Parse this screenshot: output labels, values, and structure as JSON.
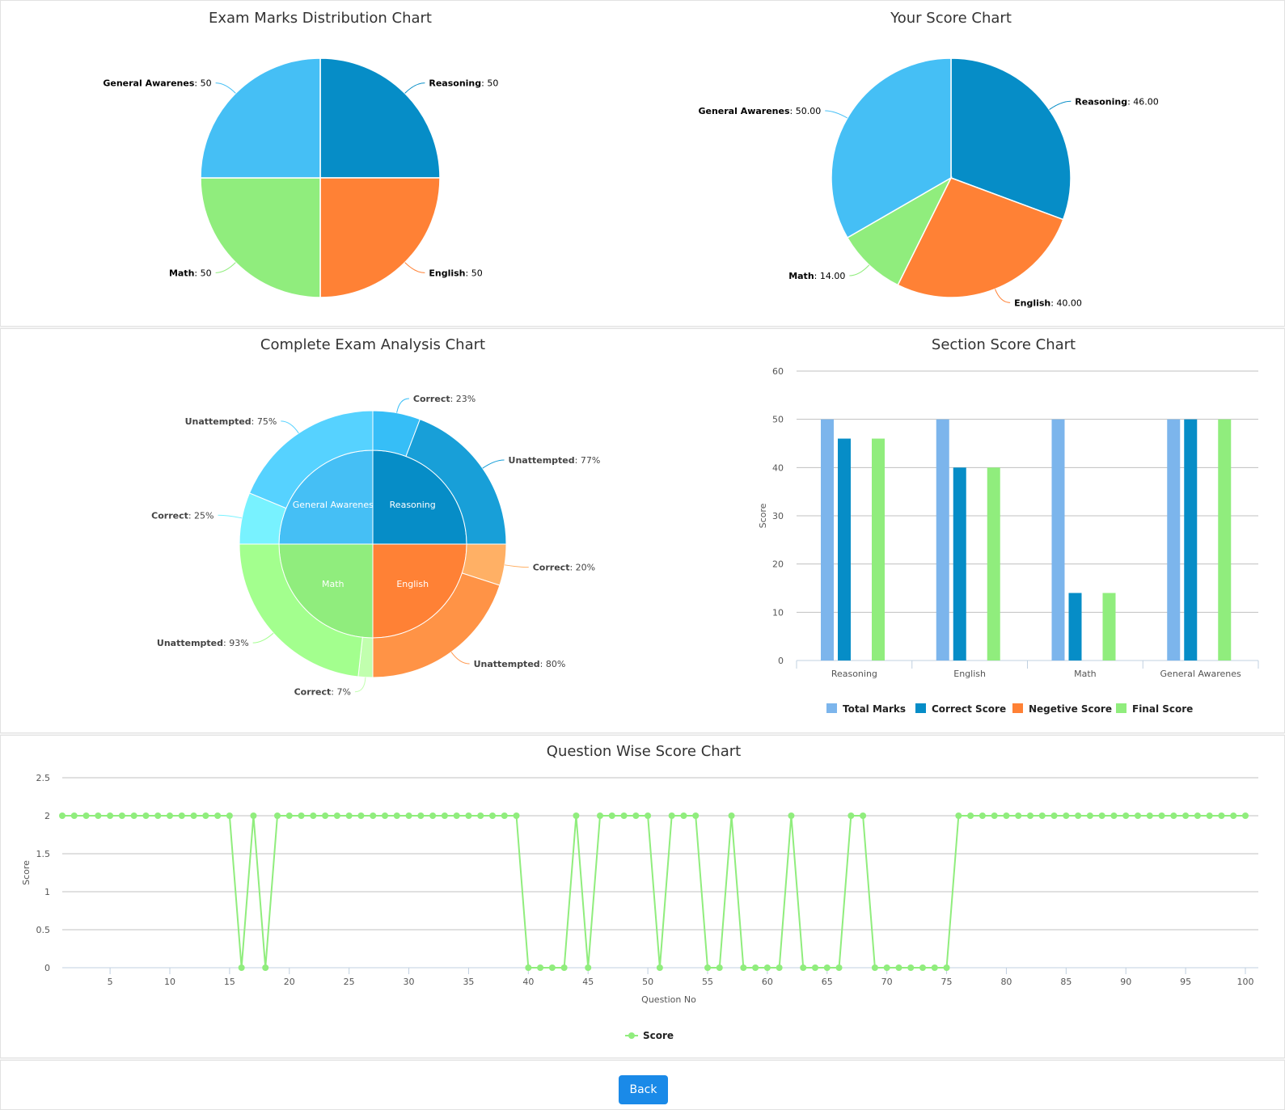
{
  "colors": {
    "reasoning": "#068dc7",
    "english": "#ff8135",
    "math": "#90ed7d",
    "general": "#45bff5",
    "total_marks": "#7cb5ec",
    "correct_score": "#068dc7",
    "negative_score": "#ff8135",
    "final_score": "#90ed7d",
    "line": "#90ed7d",
    "back_button": "#1a8ae8"
  },
  "chart_data": [
    {
      "id": "exam-marks-distribution",
      "type": "pie",
      "title": "Exam Marks Distribution Chart",
      "slices": [
        {
          "name": "Reasoning",
          "value": 50,
          "label_value": "50"
        },
        {
          "name": "English",
          "value": 50,
          "label_value": "50"
        },
        {
          "name": "Math",
          "value": 50,
          "label_value": "50"
        },
        {
          "name": "General Awarenes",
          "value": 50,
          "label_value": "50"
        }
      ]
    },
    {
      "id": "your-score",
      "type": "pie",
      "title": "Your Score Chart",
      "slices": [
        {
          "name": "Reasoning",
          "value": 46,
          "label_value": "46.00"
        },
        {
          "name": "English",
          "value": 40,
          "label_value": "40.00"
        },
        {
          "name": "Math",
          "value": 14,
          "label_value": "14.00"
        },
        {
          "name": "General Awarenes",
          "value": 50,
          "label_value": "50.00"
        }
      ]
    },
    {
      "id": "complete-exam-analysis",
      "type": "pie",
      "title": "Complete Exam Analysis Chart",
      "inner": [
        {
          "name": "Reasoning",
          "value": 25
        },
        {
          "name": "English",
          "value": 25
        },
        {
          "name": "Math",
          "value": 25
        },
        {
          "name": "General Awarenes",
          "value": 25
        }
      ],
      "outer": [
        {
          "section": "Reasoning",
          "name": "Correct",
          "value": 23,
          "label": "23%",
          "color": "#36bef7"
        },
        {
          "section": "Reasoning",
          "name": "Unattempted",
          "value": 77,
          "label": "77%",
          "color": "#189fd8"
        },
        {
          "section": "English",
          "name": "Correct",
          "value": 20,
          "label": "20%",
          "color": "#ffb065"
        },
        {
          "section": "English",
          "name": "Unattempted",
          "value": 80,
          "label": "80%",
          "color": "#ff9346"
        },
        {
          "section": "Math",
          "name": "Correct",
          "value": 7,
          "label": "7%",
          "color": "#c1ffae"
        },
        {
          "section": "Math",
          "name": "Unattempted",
          "value": 93,
          "label": "93%",
          "color": "#a3ff8e"
        },
        {
          "section": "General Awarenes",
          "name": "Correct",
          "value": 25,
          "label": "25%",
          "color": "#78f2ff"
        },
        {
          "section": "General Awarenes",
          "name": "Unattempted",
          "value": 75,
          "label": "75%",
          "color": "#56d2ff"
        }
      ]
    },
    {
      "id": "section-score",
      "type": "bar",
      "title": "Section Score Chart",
      "categories": [
        "Reasoning",
        "English",
        "Math",
        "General Awarenes"
      ],
      "ylabel": "Score",
      "xlabel": "",
      "ylim": [
        0,
        60
      ],
      "yticks": [
        0,
        10,
        20,
        30,
        40,
        50,
        60
      ],
      "grid": true,
      "legend_position": "bottom",
      "series": [
        {
          "name": "Total Marks",
          "values": [
            50,
            50,
            50,
            50
          ]
        },
        {
          "name": "Correct Score",
          "values": [
            46,
            40,
            14,
            50
          ]
        },
        {
          "name": "Negetive Score",
          "values": [
            0,
            0,
            0,
            0
          ]
        },
        {
          "name": "Final Score",
          "values": [
            46,
            40,
            14,
            50
          ]
        }
      ]
    },
    {
      "id": "question-wise-score",
      "type": "line",
      "title": "Question Wise Score Chart",
      "xlabel": "Question No",
      "ylabel": "Score",
      "xlim": [
        1,
        100
      ],
      "ylim": [
        0,
        2.5
      ],
      "xticks": [
        5,
        10,
        15,
        20,
        25,
        30,
        35,
        40,
        45,
        50,
        55,
        60,
        65,
        70,
        75,
        80,
        85,
        90,
        95,
        100
      ],
      "yticks": [
        "0",
        "0.5",
        "1",
        "1.5",
        "2",
        "2.5"
      ],
      "grid": true,
      "legend_position": "bottom",
      "series": [
        {
          "name": "Score",
          "values": [
            2,
            2,
            2,
            2,
            2,
            2,
            2,
            2,
            2,
            2,
            2,
            2,
            2,
            2,
            2,
            0,
            2,
            0,
            2,
            2,
            2,
            2,
            2,
            2,
            2,
            2,
            2,
            2,
            2,
            2,
            2,
            2,
            2,
            2,
            2,
            2,
            2,
            2,
            2,
            0,
            0,
            0,
            0,
            2,
            0,
            2,
            2,
            2,
            2,
            2,
            0,
            2,
            2,
            2,
            0,
            0,
            2,
            0,
            0,
            0,
            0,
            2,
            0,
            0,
            0,
            0,
            2,
            2,
            0,
            0,
            0,
            0,
            0,
            0,
            0,
            2,
            2,
            2,
            2,
            2,
            2,
            2,
            2,
            2,
            2,
            2,
            2,
            2,
            2,
            2,
            2,
            2,
            2,
            2,
            2,
            2,
            2,
            2,
            2,
            2
          ]
        }
      ]
    }
  ],
  "footer": {
    "back_label": "Back"
  }
}
